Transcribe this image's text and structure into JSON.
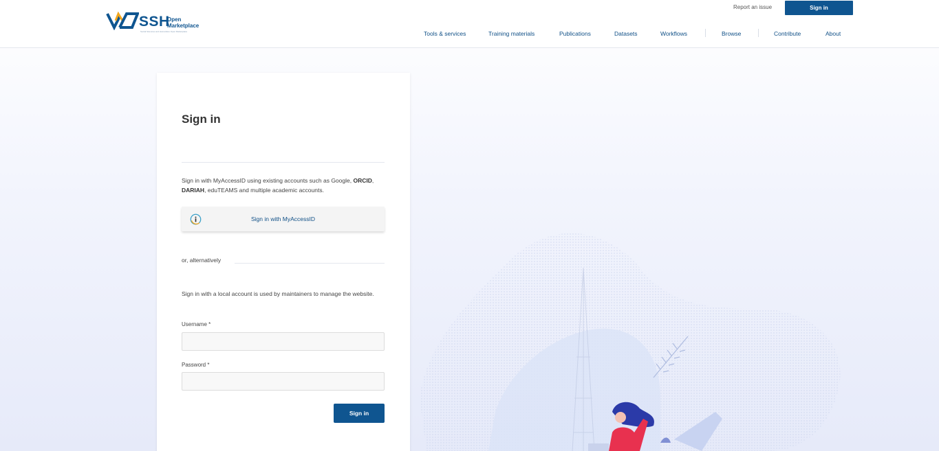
{
  "header": {
    "logo": {
      "ssh": "SSH",
      "open": "Open",
      "marketplace": "Marketplace",
      "tagline": "Social Sciences and Humanities Open Marketplace"
    },
    "report_issue": "Report an issue",
    "sign_in": "Sign in",
    "nav": [
      "Tools & services",
      "Training materials",
      "Publications",
      "Datasets",
      "Workflows",
      "Browse",
      "Contribute",
      "About"
    ]
  },
  "card": {
    "title": "Sign in",
    "intro_prefix": "Sign in with MyAccessID using existing accounts such as Google,",
    "intro_orcid": "ORCID",
    "intro_dariah": "DARIAH",
    "intro_eduteams": "eduTEAMS",
    "intro_suffix": "and multiple academic accounts.",
    "myaccessid_button": "Sign in with MyAccessID",
    "alternatively": "or, alternatively",
    "local_text": "Sign in with a local account is used by maintainers to manage the website.",
    "username_label": "Username *",
    "username_value": "",
    "password_label": "Password *",
    "password_value": "",
    "submit": "Sign in"
  },
  "colors": {
    "brand": "#0f5590",
    "accent": "#3aa0c8",
    "illustration_person": "#e8314f"
  }
}
